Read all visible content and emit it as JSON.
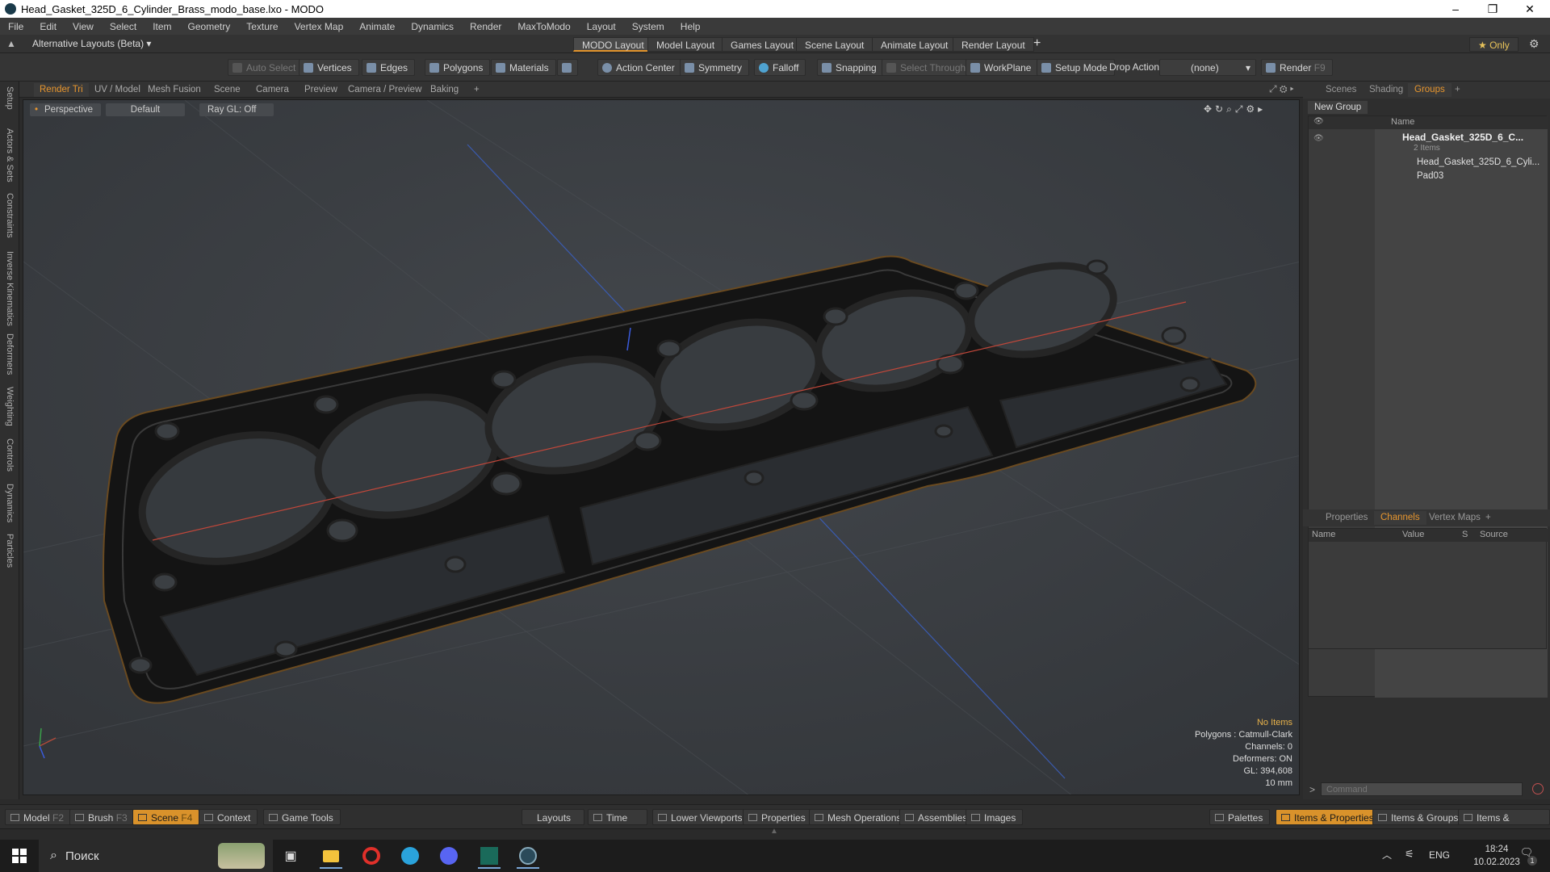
{
  "window": {
    "title": "Head_Gasket_325D_6_Cylinder_Brass_modo_base.lxo - MODO",
    "min": "–",
    "max": "❐",
    "close": "✕"
  },
  "menu": [
    "File",
    "Edit",
    "View",
    "Select",
    "Item",
    "Geometry",
    "Texture",
    "Vertex Map",
    "Animate",
    "Dynamics",
    "Render",
    "MaxToModo",
    "Layout",
    "System",
    "Help"
  ],
  "layoutbar": {
    "alt_layouts": "Alternative Layouts (Beta)",
    "tabs": [
      "MODO Layout",
      "Model Layout",
      "Games Layout",
      "Scene Layout",
      "Animate Layout",
      "Render Layout"
    ],
    "add": "+",
    "only": "★  Only"
  },
  "toolbar": {
    "auto_select": "Auto Select",
    "vertices": "Vertices",
    "edges": "Edges",
    "polygons": "Polygons",
    "materials": "Materials",
    "action_center": "Action Center",
    "symmetry": "Symmetry",
    "falloff": "Falloff",
    "snapping": "Snapping",
    "select_through": "Select Through",
    "workplane": "WorkPlane",
    "setup_mode": "Setup Mode",
    "drop_action": "Drop Action",
    "drop_value": "(none)",
    "render": "Render",
    "render_key": "F9"
  },
  "left_tabs": [
    "Setup",
    "Actors & Sets",
    "Constraints",
    "Inverse Kinematics",
    "Deformers",
    "Weighting",
    "Controls",
    "Dynamics",
    "Particles"
  ],
  "viewport_tabs": [
    "Render Tri",
    "UV / Model",
    "Mesh Fusion",
    "Scene",
    "Camera",
    "Preview",
    "Camera / Preview",
    "Baking",
    "+"
  ],
  "viewport": {
    "perspective": "Perspective",
    "shading": "Default",
    "raygl": "Ray GL: Off",
    "info": {
      "items": "No Items",
      "polygons": "Polygons : Catmull-Clark",
      "channels": "Channels: 0",
      "deformers": "Deformers: ON",
      "gl": "GL: 394,608",
      "scale": "10 mm"
    }
  },
  "right_top": {
    "tabs": [
      "Scenes",
      "Shading",
      "Groups",
      "+"
    ],
    "new_group": "New Group",
    "col_name": "Name",
    "tree": [
      {
        "label": "Head_Gasket_325D_6_C...",
        "sub": "2 Items"
      },
      {
        "label": "Head_Gasket_325D_6_Cyli..."
      },
      {
        "label": "Pad03"
      }
    ]
  },
  "right_bottom": {
    "tabs": [
      "Properties",
      "Channels",
      "Vertex Maps",
      "+"
    ],
    "cols": [
      "Name",
      "Value",
      "S",
      "Source"
    ],
    "command_placeholder": "Command"
  },
  "bottom": {
    "model": "Model",
    "model_key": "F2",
    "brush": "Brush",
    "brush_key": "F3",
    "scene": "Scene",
    "scene_key": "F4",
    "context": "Context",
    "game_tools": "Game Tools",
    "layouts": "Layouts",
    "time": "Time",
    "lower_viewports": "Lower Viewports",
    "properties": "Properties",
    "mesh_operations": "Mesh Operations",
    "assemblies": "Assemblies",
    "images": "Images",
    "palettes": "Palettes",
    "items_properties": "Items & Properties",
    "items_groups": "Items & Groups",
    "items_shading": "Items & Shading"
  },
  "taskbar": {
    "search": "Поиск",
    "lang": "ENG",
    "time": "18:24",
    "date": "10.02.2023",
    "notif": "1"
  },
  "colors": {
    "accent": "#e8962e",
    "viewport_bg": "#3a3e42",
    "panel": "#2e2e2e"
  }
}
